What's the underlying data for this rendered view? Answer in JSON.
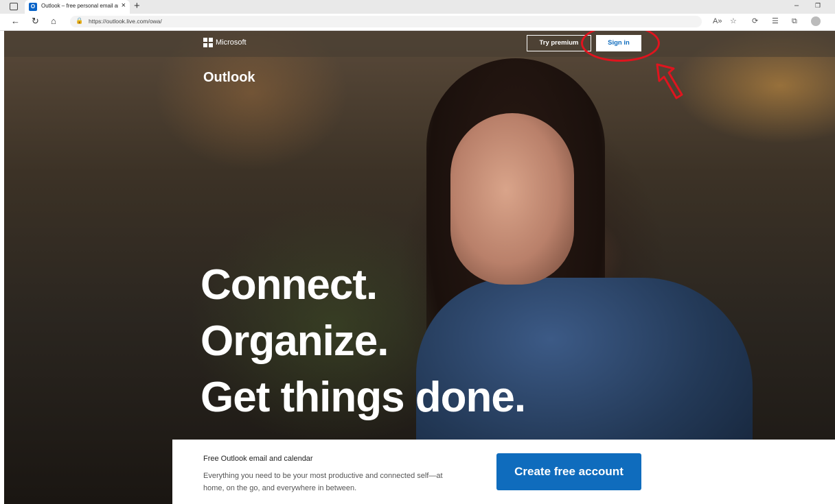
{
  "browser": {
    "tab_title": "Outlook – free personal email an",
    "tab_favicon": "O",
    "url": "https://outlook.live.com/owa/",
    "icons": [
      "tab-actions-icon",
      "close-icon",
      "new-tab-icon",
      "minimize-icon",
      "restore-icon",
      "back-icon",
      "refresh-icon",
      "home-icon",
      "lock-icon",
      "read-aloud-icon",
      "favorite-icon",
      "extensions-icon",
      "favorites-icon",
      "collections-icon",
      "profile-icon"
    ]
  },
  "header": {
    "brand": "Microsoft",
    "try_premium": "Try premium",
    "sign_in": "Sign in"
  },
  "product": {
    "name": "Outlook"
  },
  "hero": {
    "line1": "Connect.",
    "line2": "Organize.",
    "line3": "Get things done."
  },
  "promo": {
    "title": "Free Outlook email and calendar",
    "description": "Everything you need to be your most productive and connected self—at home, on the go, and everywhere in between.",
    "cta": "Create free account"
  },
  "colors": {
    "accent": "#0f6cbd",
    "annotation": "#e0141e"
  }
}
